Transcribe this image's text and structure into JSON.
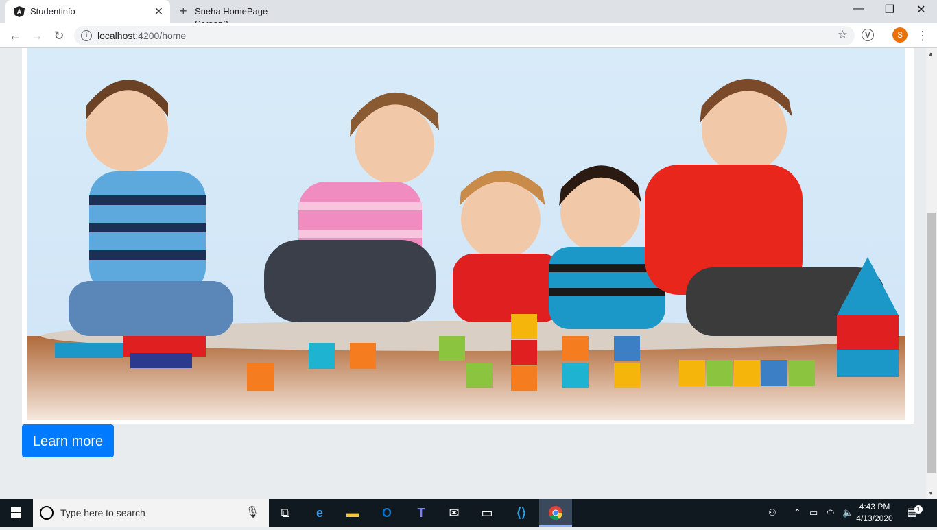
{
  "browser": {
    "tabs": [
      {
        "title": "Studentinfo"
      },
      {
        "title": "Sneha HomePage Screen2"
      }
    ],
    "address": {
      "host": "localhost",
      "path": ":4200/home"
    },
    "profile_initial": "S"
  },
  "page": {
    "hero_image_alt": "children playing with blocks",
    "learn_more_label": "Learn more",
    "colors": {
      "button": "#007bff",
      "background": "#e9ecef"
    }
  },
  "taskbar": {
    "search_placeholder": "Type here to search",
    "time": "4:43 PM",
    "date": "4/13/2020",
    "notification_count": "1"
  }
}
